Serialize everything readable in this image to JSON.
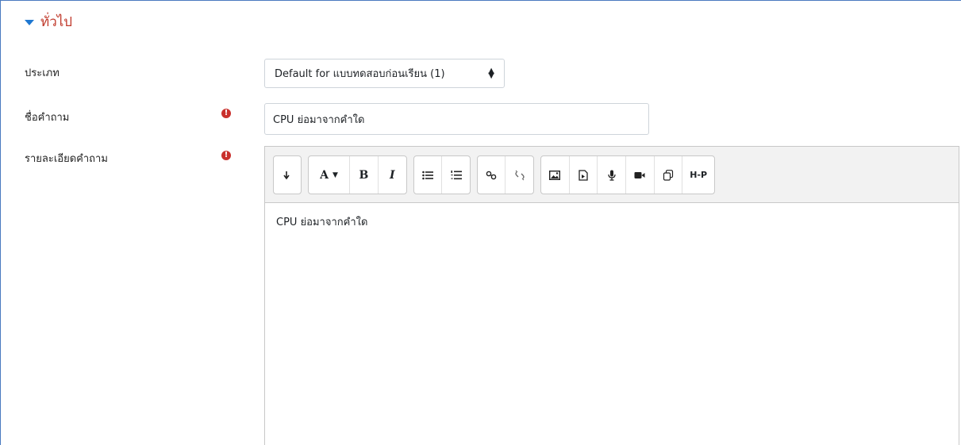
{
  "section": {
    "title": "ทั่วไป"
  },
  "fields": {
    "type": {
      "label": "ประเภท",
      "value": "Default for แบบทดสอบก่อนเรียน (1)"
    },
    "question_name": {
      "label": "ชื่อคำถาม",
      "value": "CPU ย่อมาจากคำใด"
    },
    "question_text": {
      "label": "รายละเอียดคำถาม",
      "value": "CPU ย่อมาจากคำใด"
    }
  },
  "required_icon": "exclamation-circle-icon",
  "toolbar": {
    "font_label": "A",
    "bold_label": "B",
    "italic_label": "I",
    "h5p_label": "H-P"
  },
  "colors": {
    "accent": "#1f78d1",
    "section_title": "#c0392b",
    "required": "#c9302c"
  }
}
